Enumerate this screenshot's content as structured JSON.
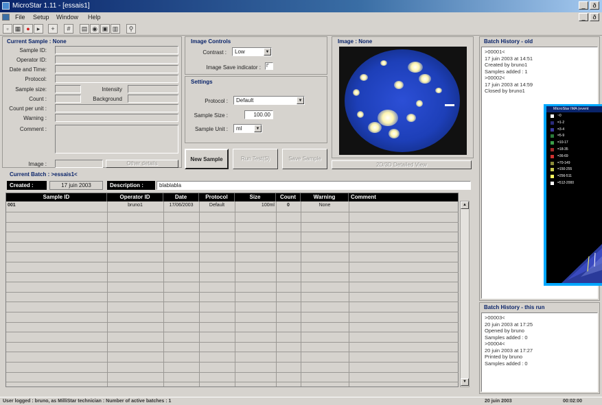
{
  "window": {
    "title": "MicroStar 1.11 - [essais1]",
    "min": "_",
    "max": "ð"
  },
  "menu": [
    "File",
    "Setup",
    "Window",
    "Help"
  ],
  "child_controls": {
    "min": "_",
    "max": "ð"
  },
  "toolbar": [
    {
      "icon": "new-icon",
      "glyph": "▫"
    },
    {
      "icon": "open-icon",
      "glyph": "▦"
    },
    {
      "icon": "record-icon",
      "glyph": "●"
    },
    {
      "icon": "play-icon",
      "glyph": "▸"
    },
    {
      "icon": "crosshair-icon",
      "glyph": "+"
    },
    {
      "icon": "grid-icon",
      "glyph": "#"
    },
    {
      "icon": "chart-icon",
      "glyph": "▤"
    },
    {
      "icon": "camera-icon",
      "glyph": "◉"
    },
    {
      "icon": "image-icon",
      "glyph": "▣"
    },
    {
      "icon": "print-icon",
      "glyph": "▥"
    },
    {
      "icon": "search-icon",
      "glyph": "⚲"
    }
  ],
  "current_sample": {
    "title": "Current Sample : None",
    "labels": [
      "Sample ID:",
      "Operator ID:",
      "Date and Time:",
      "Protocol:",
      "Sample size:",
      "Count :",
      "Count per unit :",
      "Warning :",
      "Comment :"
    ],
    "intensity": "Intensity",
    "background": "Background",
    "image": "Image :",
    "other_details": "Other details"
  },
  "image_controls": {
    "title": "Image Controls",
    "contrast_label": "Contrast :",
    "contrast_value": "Low",
    "save_indicator": "Image Save indicator :",
    "save_checkbox": "Г"
  },
  "settings": {
    "title": "Settings",
    "protocol_label": "Protocol :",
    "protocol_value": "Default",
    "sample_size_label": "Sample Size :",
    "sample_size_value": "100.00",
    "sample_unit_label": "Sample Unit :",
    "sample_unit_value": "ml"
  },
  "actions": {
    "new_sample": "New Sample",
    "run_test": "Run Test(S)",
    "save_sample": "Save Sample"
  },
  "image_panel": {
    "title": "Image : None",
    "detailed_view": "2D/3D Detailed View"
  },
  "batch": {
    "title": "Current Batch : >essais1<",
    "created_label": "Created :",
    "created_value": "17 juin 2003",
    "description_label": "Description :",
    "description_value": "blablabla",
    "columns": [
      "Sample ID",
      "Operator ID",
      "Date",
      "Protocol",
      "Size",
      "Count",
      "Warning",
      "Comment"
    ],
    "rows": [
      [
        "001",
        "bruno1",
        "17/06/2003",
        "Default",
        "100ml",
        "0",
        "None",
        ""
      ]
    ]
  },
  "history_old": {
    "title": "Batch History - old",
    "lines": [
      ">00001<",
      "17 juin 2003 at 14:51",
      "Created by bruno1",
      "Samples added : 1",
      ">00002<",
      "17 juin 2003 at 14:59",
      "Closed by bruno1"
    ]
  },
  "history_run": {
    "title": "Batch History - this run",
    "lines": [
      ">00003<",
      "20 juin 2003 at 17:25",
      "Opened by bruno",
      "Samples added : 0",
      ">00004<",
      "20 juin 2003 at 17:27",
      "Printed by bruno",
      "Samples added : 0"
    ]
  },
  "popup3d": {
    "title": "MicroStar IMA (event",
    "legend": [
      {
        "label": "~0",
        "color": "#ffffff"
      },
      {
        "label": "=1-2",
        "color": "#2a2a7a"
      },
      {
        "label": "=3-4",
        "color": "#3a3aa0"
      },
      {
        "label": "=5-9",
        "color": "#2a7a3a"
      },
      {
        "label": "=10-17",
        "color": "#3aa04a"
      },
      {
        "label": "=18-35",
        "color": "#a02a2a"
      },
      {
        "label": "=36-69",
        "color": "#d03030"
      },
      {
        "label": "=70-149",
        "color": "#8a8a3a"
      },
      {
        "label": "=150-255",
        "color": "#c8c850"
      },
      {
        "label": "=256-511",
        "color": "#ffff60"
      },
      {
        "label": "=512-2000",
        "color": "#ffffff"
      }
    ]
  },
  "status": {
    "message": "User logged : bruno, as MilliStar technician :   Number of active batches : 1",
    "date": "20 juin 2003",
    "time": "00:02:00"
  }
}
